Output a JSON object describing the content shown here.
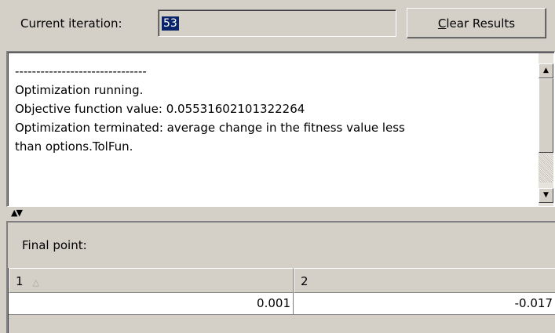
{
  "header": {
    "iteration_label": "Current iteration:",
    "iteration_value": "53",
    "clear_prefix": "C",
    "clear_rest": "lear Results"
  },
  "output": {
    "text": "-------------------------------\nOptimization running.\nObjective function value: 0.05531602101322264\nOptimization terminated: average change in the fitness value less\nthan options.TolFun."
  },
  "final_point": {
    "label": "Final point:",
    "columns": [
      "1",
      "2"
    ],
    "values": [
      "0.001",
      "-0.017"
    ]
  },
  "colors": {
    "panel_bg": "#d4d0c8",
    "selection": "#0a246a"
  },
  "icons": {
    "sort": "sort-ascending-icon",
    "scroll_up": "up-arrow-icon",
    "scroll_down": "down-arrow-icon",
    "splitter": "splitter-arrows-icon"
  }
}
